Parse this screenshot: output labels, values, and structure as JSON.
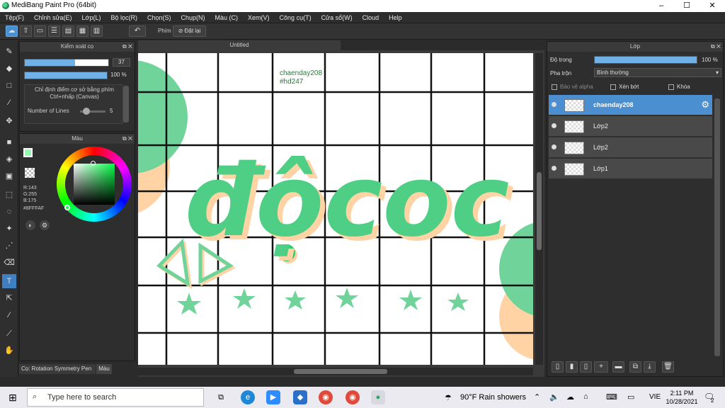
{
  "window": {
    "title": "MediBang Paint Pro (64bit)",
    "minimize": "–",
    "maximize": "☐",
    "close": "✕"
  },
  "menu": [
    "Tệp(F)",
    "Chỉnh sửa(E)",
    "Lớp(L)",
    "Bộ lọc(R)",
    "Chọn(S)",
    "Chụp(N)",
    "Màu (C)",
    "Xem(V)",
    "Công cụ(T)",
    "Cửa sổ(W)",
    "Cloud",
    "Help"
  ],
  "toolbar": {
    "brush_label": "Phím",
    "reset_label": "Đặt lại"
  },
  "brush_panel": {
    "title": "Kiểm soát cọ",
    "size_value": "37",
    "size_fill": 0.6,
    "opacity_value": "100 %",
    "opacity_fill": 1.0,
    "hint_line1": "Chỉ định điểm cơ sở bằng phím",
    "hint_line2": "Ctrl+nhấp (Canvas)",
    "lines_label": "Number of Lines",
    "lines_value": "5"
  },
  "color_panel": {
    "title": "Màu",
    "r": "R:143",
    "g": "G:255",
    "b": "B:175",
    "hex": "#8FFFAF",
    "fg_color": "#8FFFAF"
  },
  "bottom_tabs": {
    "brush_tab": "Cọ: Rotation Symmetry Pen",
    "color_tab": "Màu"
  },
  "canvas": {
    "tab_title": "Untitled",
    "credit_line1": "chaenday208",
    "credit_line2": "#hd247",
    "art_text": "độcoc"
  },
  "layer_panel": {
    "title": "Lớp",
    "opacity_label": "Độ trong",
    "opacity_value": "100 %",
    "blend_label": "Pha trộn",
    "blend_value": "Bình thường",
    "protect_alpha": "Bảo vệ alpha",
    "clipping": "Xén bớt",
    "lock": "Khóa",
    "layers": [
      {
        "name": "chaenday208",
        "selected": true
      },
      {
        "name": "Lớp2",
        "selected": false
      },
      {
        "name": "Lớp2",
        "selected": false
      },
      {
        "name": "Lớp1",
        "selected": false
      }
    ]
  },
  "taskbar": {
    "search_placeholder": "Type here to search",
    "weather": "90°F  Rain showers",
    "lang": "VIE",
    "time": "2:11 PM",
    "date": "10/28/2021",
    "notif_count": "2"
  },
  "colors": {
    "accent": "#4b8fd1",
    "mint": "#6fd39a",
    "peach": "#ffd3a3"
  }
}
